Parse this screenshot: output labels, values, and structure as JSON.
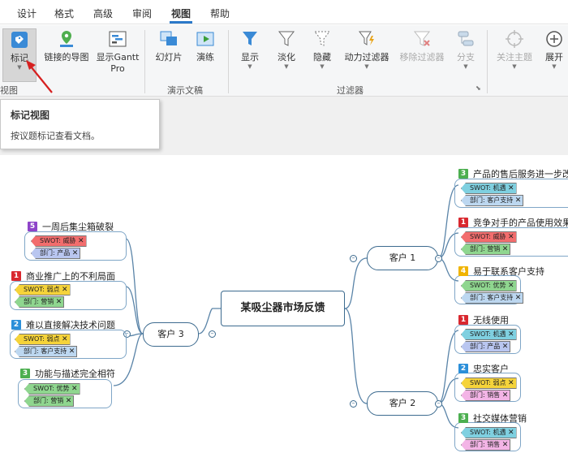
{
  "tabs": [
    "设计",
    "格式",
    "高级",
    "审阅",
    "视图",
    "帮助"
  ],
  "tools": {
    "mark": "标记",
    "linked_map": "链接的导图",
    "gantt1": "显示Gantt",
    "gantt2": "Pro",
    "slides": "幻灯片",
    "rehearse": "演练",
    "show": "显示",
    "fade": "淡化",
    "hide": "隐藏",
    "dyn_filter": "动力过滤器",
    "remove_filter": "移除过滤器",
    "branch": "分支",
    "focus_topic": "关注主题",
    "expand": "展开"
  },
  "groups": {
    "view": "视图",
    "presentation": "演示文稿",
    "filter": "过滤器"
  },
  "tooltip": {
    "title": "标记视图",
    "desc": "按议题标记查看文档。"
  },
  "colors": {
    "accent": "#2b79c9",
    "swot": "#7fd0e0",
    "threat": "#f26d6d",
    "weak": "#f5d33a",
    "strength": "#8fd68f",
    "product": "#b9c6f0",
    "support": "#bcd7f0",
    "sales": "#f3b4e6"
  },
  "map": {
    "root": "某吸尘器市场反馈",
    "c1": "客户 1",
    "c2": "客户 2",
    "c3": "客户 3",
    "c1_topics": [
      {
        "pri": "3",
        "text": "产品的售后服务进一步改善",
        "swot": "SWOT: 机遇",
        "dept": "部门: 客户支持"
      },
      {
        "pri": "1",
        "text": "竞争对手的产品使用效果更",
        "swot": "SWOT: 威胁",
        "dept": "部门: 营销"
      },
      {
        "pri": "4",
        "text": "易于联系客户支持",
        "swot": "SWOT: 优势",
        "dept": "部门: 客户支持"
      }
    ],
    "c2_topics": [
      {
        "pri": "1",
        "text": "无线使用",
        "swot": "SWOT: 机遇",
        "dept": "部门: 产品"
      },
      {
        "pri": "2",
        "text": "忠实客户",
        "swot": "SWOT: 弱点",
        "dept": "部门: 销售"
      },
      {
        "pri": "3",
        "text": "社交媒体营销",
        "swot": "SWOT: 机遇",
        "dept": "部门: 销售"
      }
    ],
    "c3_topics": [
      {
        "pri": "5",
        "text": "一周后集尘箱破裂",
        "swot": "SWOT: 威胁",
        "dept": "部门: 产品"
      },
      {
        "pri": "1",
        "text": "商业推广上的不利局面",
        "swot": "SWOT: 弱点",
        "dept": "部门: 营销"
      },
      {
        "pri": "2",
        "text": "难以直接解决技术问题",
        "swot": "SWOT: 弱点",
        "dept": "部门: 客户支持"
      },
      {
        "pri": "3",
        "text": "功能与描述完全相符",
        "swot": "SWOT: 优势",
        "dept": "部门: 营销"
      }
    ],
    "close": "✕"
  }
}
